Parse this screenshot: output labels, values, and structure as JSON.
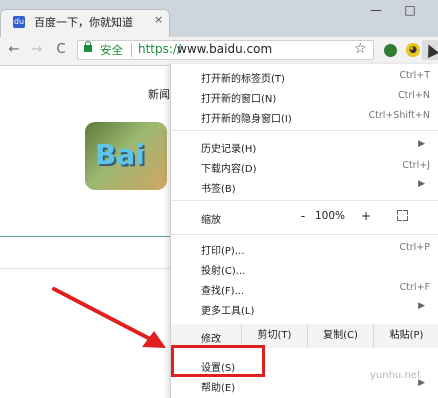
{
  "tab": {
    "title": "百度一下，你就知道",
    "close": "×",
    "favicon": "百度"
  },
  "window": {
    "minimize": "—",
    "maximize": "□"
  },
  "toolbar": {
    "back": "←",
    "forward": "→",
    "reload": "C",
    "secure_label": "安全",
    "url_scheme": "https://",
    "url_host": "www.baidu.com",
    "bookmark_star": "☆"
  },
  "page": {
    "news": "新闻",
    "logo_text": "Bai"
  },
  "menu": {
    "items": [
      {
        "label": "打开新的标签页(T)",
        "shortcut": "Ctrl+T"
      },
      {
        "label": "打开新的窗口(N)",
        "shortcut": "Ctrl+N"
      },
      {
        "label": "打开新的隐身窗口(I)",
        "shortcut": "Ctrl+Shift+N"
      },
      {
        "label": "历史记录(H)",
        "submenu": true
      },
      {
        "label": "下载内容(D)",
        "shortcut": "Ctrl+J"
      },
      {
        "label": "书签(B)",
        "submenu": true
      },
      {
        "label": "打印(P)...",
        "shortcut": "Ctrl+P"
      },
      {
        "label": "投射(C)..."
      },
      {
        "label": "查找(F)...",
        "shortcut": "Ctrl+F"
      },
      {
        "label": "更多工具(L)",
        "submenu": true
      },
      {
        "label": "设置(S)"
      },
      {
        "label": "帮助(E)",
        "submenu": true
      }
    ],
    "zoom": {
      "label": "缩放",
      "minus": "-",
      "value": "100%",
      "plus": "+"
    },
    "edit": {
      "label": "修改",
      "cut": "剪切(T)",
      "copy": "复制(C)",
      "paste": "粘贴(P)"
    }
  },
  "watermark": "yunhu.net",
  "colors": {
    "highlight": "#e02020",
    "secure_green": "#1e8e3e"
  }
}
